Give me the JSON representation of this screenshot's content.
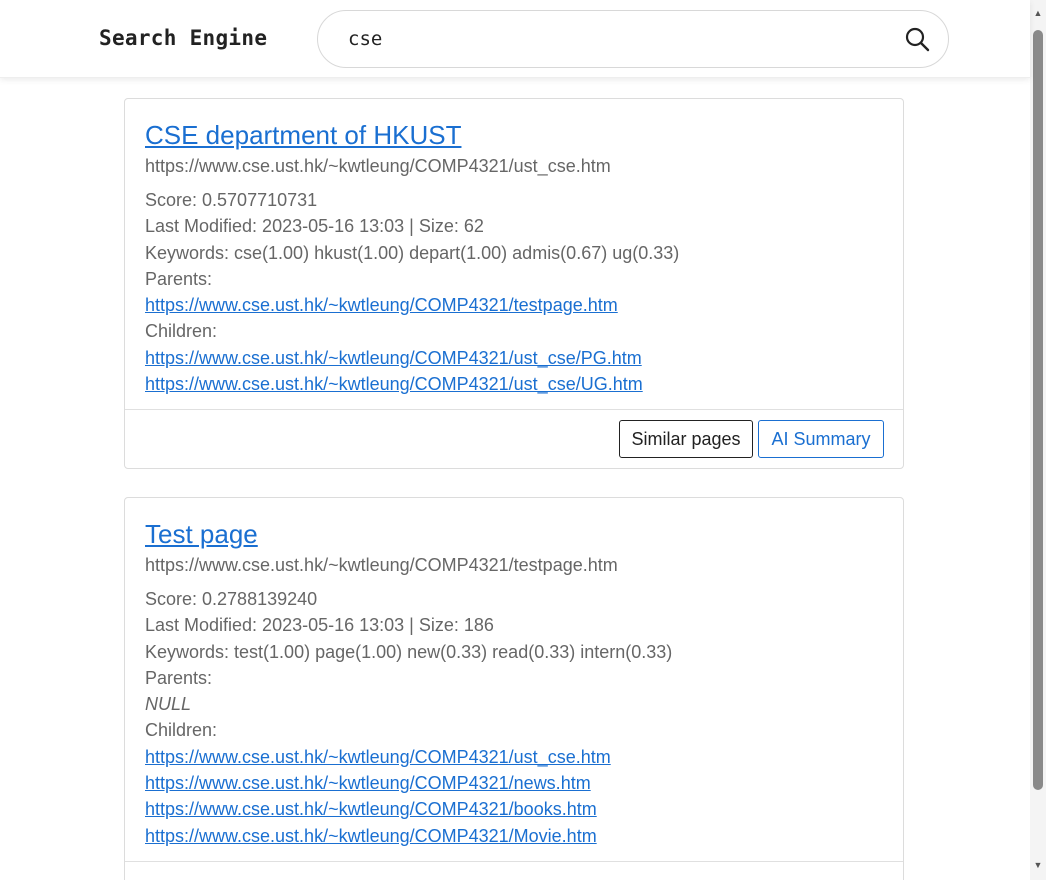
{
  "header": {
    "brand": "Search Engine",
    "search": {
      "value": "cse",
      "placeholder": ""
    },
    "search_icon": "search-icon"
  },
  "results": [
    {
      "title": "CSE department of HKUST",
      "url": "https://www.cse.ust.hk/~kwtleung/COMP4321/ust_cse.htm",
      "score": "Score: 0.5707710731",
      "meta": "Last Modified: 2023-05-16 13:03 | Size: 62",
      "keywords": "Keywords: cse(1.00) hkust(1.00) depart(1.00) admis(0.67) ug(0.33)",
      "parents_label": "Parents:",
      "parents": [
        "https://www.cse.ust.hk/~kwtleung/COMP4321/testpage.htm"
      ],
      "children_label": "Children:",
      "children": [
        "https://www.cse.ust.hk/~kwtleung/COMP4321/ust_cse/PG.htm",
        "https://www.cse.ust.hk/~kwtleung/COMP4321/ust_cse/UG.htm"
      ],
      "similar_label": "Similar pages",
      "ai_label": "AI Summary"
    },
    {
      "title": "Test page",
      "url": "https://www.cse.ust.hk/~kwtleung/COMP4321/testpage.htm",
      "score": "Score: 0.2788139240",
      "meta": "Last Modified: 2023-05-16 13:03 | Size: 186",
      "keywords": "Keywords: test(1.00) page(1.00) new(0.33) read(0.33) intern(0.33)",
      "parents_label": "Parents:",
      "parents_null": "NULL",
      "children_label": "Children:",
      "children": [
        "https://www.cse.ust.hk/~kwtleung/COMP4321/ust_cse.htm",
        "https://www.cse.ust.hk/~kwtleung/COMP4321/news.htm",
        "https://www.cse.ust.hk/~kwtleung/COMP4321/books.htm",
        "https://www.cse.ust.hk/~kwtleung/COMP4321/Movie.htm"
      ]
    }
  ],
  "colors": {
    "link": "#1a6fd1",
    "text": "#666666",
    "border": "#dcdcdc"
  }
}
